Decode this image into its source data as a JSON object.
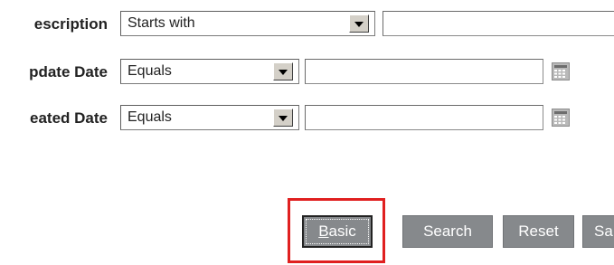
{
  "filters": [
    {
      "label": "escription",
      "operator": "Starts with",
      "value": "",
      "has_calendar": false
    },
    {
      "label": "pdate Date",
      "operator": "Equals",
      "value": "",
      "has_calendar": true
    },
    {
      "label": "eated Date",
      "operator": "Equals",
      "value": "",
      "has_calendar": true
    }
  ],
  "buttons": {
    "basic_access_key": "B",
    "basic_rest": "asic",
    "search": "Search",
    "reset": "Reset",
    "save_partial": "Sa"
  },
  "icons": {
    "dropdown": "chevron-down-icon",
    "calendar": "calendar-icon"
  },
  "colors": {
    "button_bg": "#86898c",
    "highlight": "#e02020",
    "select_arrow_bg": "#d4d0c8"
  }
}
